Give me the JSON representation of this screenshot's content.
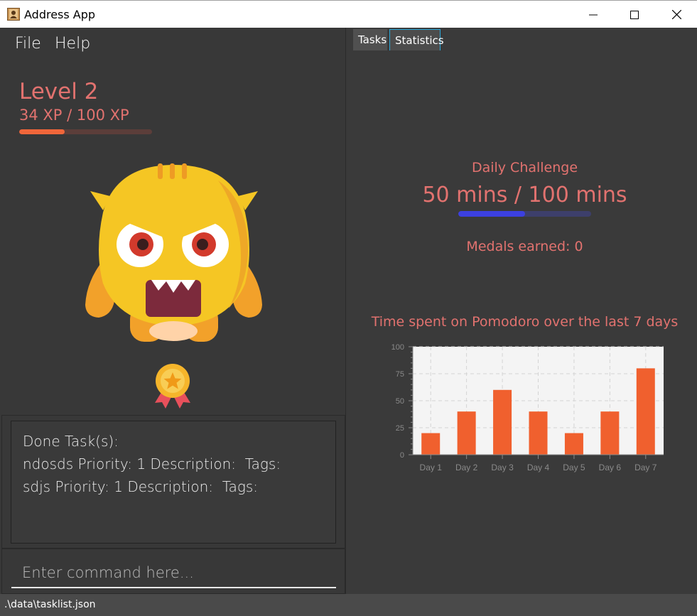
{
  "window": {
    "title": "Address App"
  },
  "menu": {
    "file": "File",
    "help": "Help"
  },
  "level": {
    "title": "Level 2",
    "xp_text": "34 XP / 100 XP",
    "xp_progress": 0.34
  },
  "done_tasks": {
    "header": "Done Task(s):",
    "items": [
      "ndosds Priority: 1 Description:  Tags:",
      "sdjs Priority: 1 Description:  Tags:"
    ]
  },
  "command": {
    "placeholder": "Enter command here..."
  },
  "tabs": {
    "tasks": "Tasks",
    "statistics": "Statistics",
    "active": "statistics"
  },
  "daily": {
    "title": "Daily Challenge",
    "value": "50 mins / 100 mins",
    "progress": 0.5
  },
  "medals": {
    "text": "Medals earned: 0"
  },
  "chart_title": "Time spent on Pomodoro over the last 7 days",
  "chart_data": {
    "type": "bar",
    "categories": [
      "Day 1",
      "Day 2",
      "Day 3",
      "Day 4",
      "Day 5",
      "Day 6",
      "Day 7"
    ],
    "values": [
      20,
      40,
      60,
      40,
      20,
      40,
      80
    ],
    "yticks": [
      0,
      25,
      50,
      75,
      100
    ],
    "ylim": [
      0,
      100
    ],
    "grid": true,
    "bar_color": "#f0602e"
  },
  "status": {
    "path": ".\\data\\tasklist.json"
  },
  "colors": {
    "accent": "#e2726f",
    "xp_fill": "#f0663a",
    "daily_fill": "#3c40e0",
    "tab_border": "#2aa7d8"
  }
}
